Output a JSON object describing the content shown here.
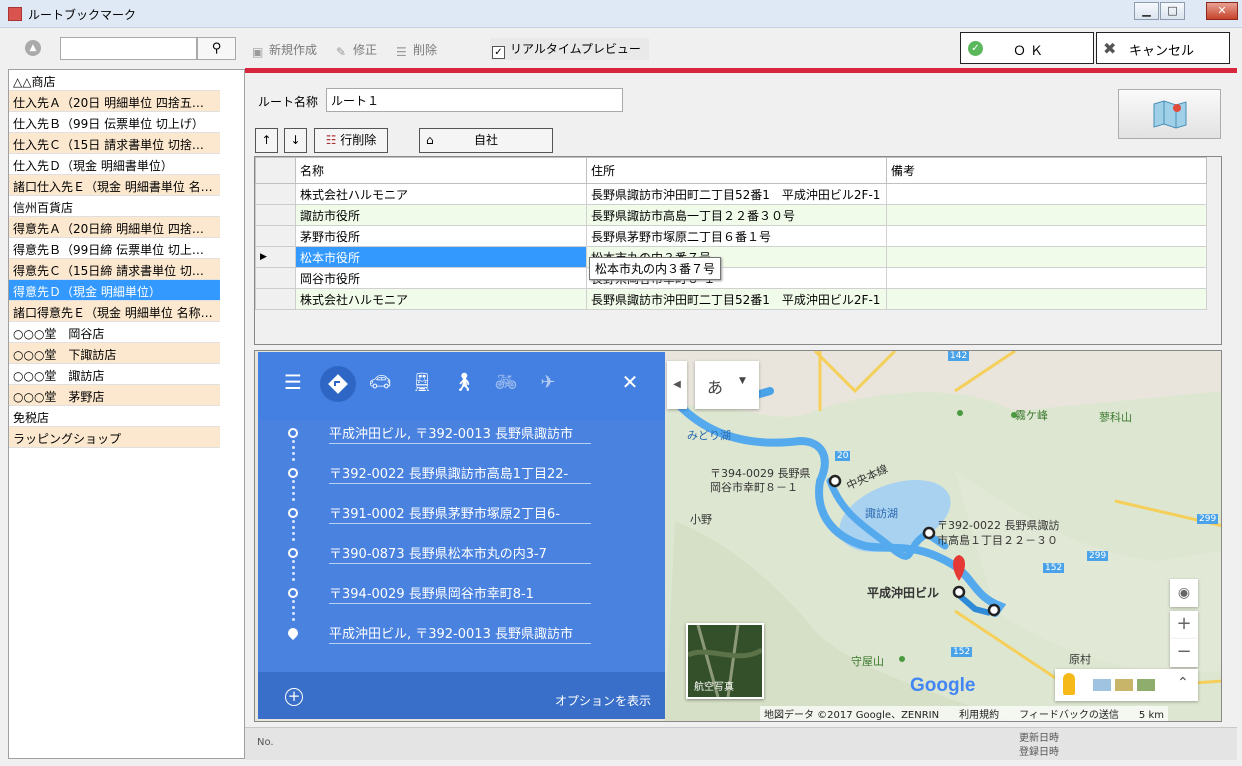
{
  "window": {
    "title": "ルートブックマーク",
    "min": "▁",
    "max": "□",
    "close": "✕"
  },
  "toolbar": {
    "new_label": "新規作成",
    "edit_label": "修正",
    "delete_label": "削除",
    "realtime_label": "リアルタイムプレビュー",
    "realtime_checked": "✓",
    "search_value": "",
    "ok_label": "ＯＫ",
    "cancel_label": "キャンセル"
  },
  "list": [
    {
      "label": "△△商店",
      "alt": false
    },
    {
      "label": "仕入先Ａ（20日 明細単位 四捨五…",
      "alt": true
    },
    {
      "label": "仕入先Ｂ（99日 伝票単位 切上げ）",
      "alt": false
    },
    {
      "label": "仕入先Ｃ（15日 請求書単位 切捨…",
      "alt": true
    },
    {
      "label": "仕入先Ｄ（現金 明細書単位）",
      "alt": false
    },
    {
      "label": "諸口仕入先Ｅ（現金 明細書単位 名…",
      "alt": true
    },
    {
      "label": "信州百貨店",
      "alt": false
    },
    {
      "label": "得意先Ａ（20日締 明細単位 四捨…",
      "alt": true
    },
    {
      "label": "得意先Ｂ（99日締 伝票単位 切上…",
      "alt": false
    },
    {
      "label": "得意先Ｃ（15日締 請求書単位 切…",
      "alt": true
    },
    {
      "label": "得意先Ｄ（現金 明細単位）",
      "alt": false,
      "selected": true
    },
    {
      "label": "諸口得意先Ｅ（現金 明細単位 名称…",
      "alt": true
    },
    {
      "label": "○○○堂　岡谷店",
      "alt": false
    },
    {
      "label": "○○○堂　下諏訪店",
      "alt": true
    },
    {
      "label": "○○○堂　諏訪店",
      "alt": false
    },
    {
      "label": "○○○堂　茅野店",
      "alt": true
    },
    {
      "label": "免税店",
      "alt": false
    },
    {
      "label": "ラッピングショップ",
      "alt": true
    }
  ],
  "route": {
    "name_label": "ルート名称",
    "name_value": "ルート１",
    "up_label": "↑",
    "down_label": "↓",
    "delete_row_label": "行削除",
    "home_label": "自社"
  },
  "grid": {
    "headers": [
      "名称",
      "住所",
      "備考"
    ],
    "rows": [
      {
        "name": "株式会社ハルモニア",
        "address": "長野県諏訪市沖田町二丁目52番1　平成沖田ビル2F-1",
        "note": ""
      },
      {
        "name": "諏訪市役所",
        "address": "長野県諏訪市高島一丁目２２番３０号",
        "note": ""
      },
      {
        "name": "茅野市役所",
        "address": "長野県茅野市塚原二丁目６番１号",
        "note": ""
      },
      {
        "name": "松本市役所",
        "address": "松本市丸の内３番７号",
        "note": ""
      },
      {
        "name": "岡谷市役所",
        "address": "長野県岡谷市幸町８-１",
        "note": ""
      },
      {
        "name": "株式会社ハルモニア",
        "address": "長野県諏訪市沖田町二丁目52番1　平成沖田ビル2F-1",
        "note": ""
      }
    ],
    "tooltip": "松本市丸の内３番７号",
    "current_marker": "▶"
  },
  "map": {
    "waypoints": [
      "平成沖田ビル, 〒392-0013 長野県諏訪市",
      "〒392-0022 長野県諏訪市高島1丁目22-",
      "〒391-0002 長野県茅野市塚原2丁目6-",
      "〒390-0873 長野県松本市丸の内3-7",
      "〒394-0029 長野県岡谷市幸町8-1",
      "平成沖田ビル, 〒392-0013 長野県諏訪市"
    ],
    "options_label": "オプションを表示",
    "add_symbol": "+",
    "close_symbol": "✕",
    "menu_symbol": "☰",
    "ime_label": "あ",
    "labels": {
      "kirigamine": "霧ケ峰",
      "tateshina": "蓼科山",
      "midori": "みどり湖",
      "okaya_addr1": "〒394-0029 長野県",
      "okaya_addr2": "岡谷市幸町８－１",
      "chuo": "中央本線",
      "suwako": "諏訪湖",
      "ono": "小野",
      "suwa_addr1": "〒392-0022 長野県諏訪",
      "suwa_addr2": "市高島１丁目２２－３０",
      "okita": "平成沖田ビル",
      "moriya": "守屋山",
      "hara": "原村",
      "r20": "20",
      "r142": "142",
      "r299a": "299",
      "r299b": "299",
      "r152a": "152",
      "r152b": "152"
    },
    "aerial_label": "航空写真",
    "google_logo": "Google",
    "attribution": "地図データ ©2017 Google、ZENRIN　　利用規約　　フィードバックの送信　　5 km",
    "zoom_in": "+",
    "zoom_out": "−"
  },
  "status": {
    "no_label": "No.",
    "updated_label": "更新日時",
    "registered_label": "登録日時"
  }
}
